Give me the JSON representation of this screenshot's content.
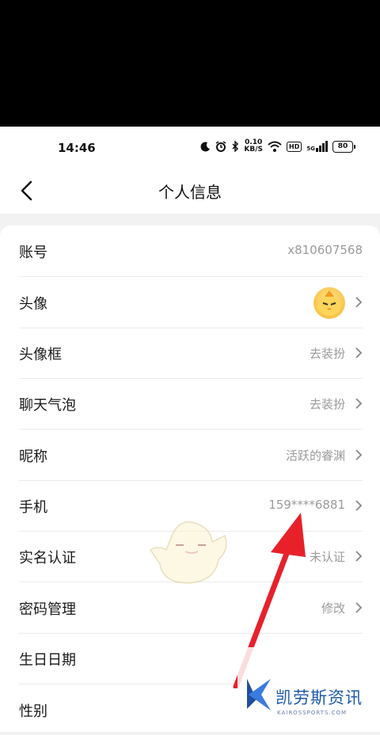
{
  "status_bar": {
    "time": "14:46",
    "net_speed_value": "0.10",
    "net_speed_unit": "KB/S",
    "hd_label": "HD",
    "sim_label": "5G",
    "battery": "80"
  },
  "header": {
    "title": "个人信息"
  },
  "rows": [
    {
      "label": "账号",
      "value": "x810607568"
    },
    {
      "label": "头像",
      "value": ""
    },
    {
      "label": "头像框",
      "value": "去装扮"
    },
    {
      "label": "聊天气泡",
      "value": "去装扮"
    },
    {
      "label": "昵称",
      "value": "活跃的睿渊"
    },
    {
      "label": "手机",
      "value": "159****6881"
    },
    {
      "label": "实名认证",
      "value": "未认证"
    },
    {
      "label": "密码管理",
      "value": "修改"
    },
    {
      "label": "生日日期",
      "value": ""
    },
    {
      "label": "性别",
      "value": ""
    }
  ],
  "watermark": {
    "name_cn": "凯劳斯资讯",
    "name_en": "KAIROSSPORTS.COM"
  },
  "colors": {
    "annotation_arrow": "#e8202a",
    "value_text": "#9a9a9a",
    "logo_blue": "#1f5ba8"
  }
}
